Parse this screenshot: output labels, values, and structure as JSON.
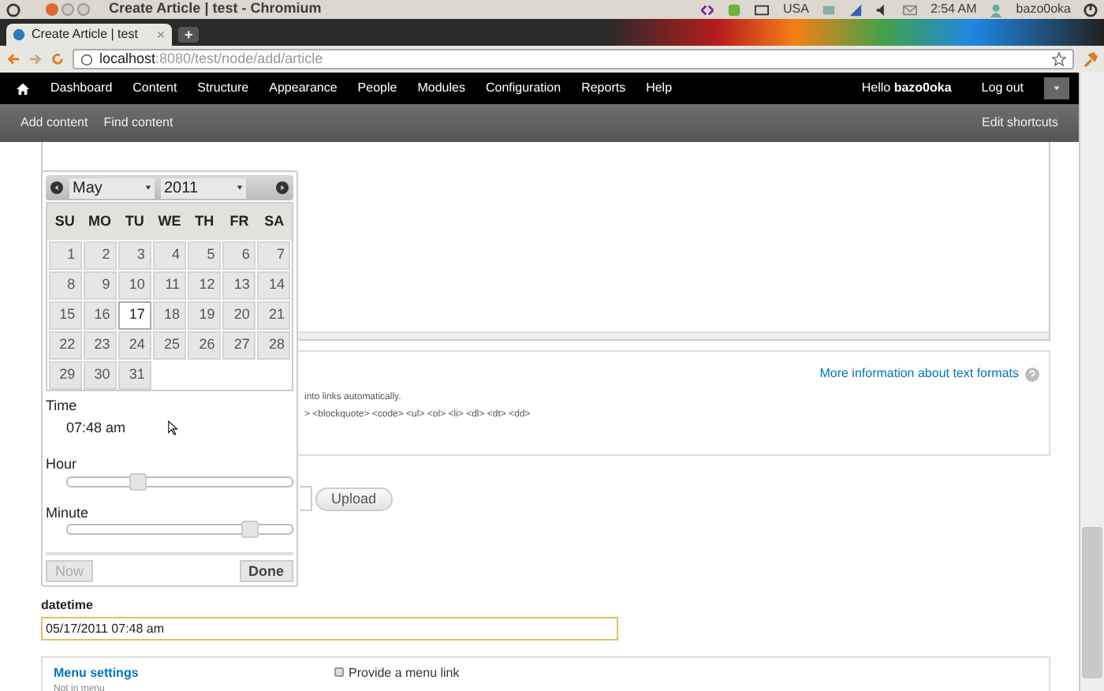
{
  "panel": {
    "window_title": "Create Article | test - Chromium",
    "keyboard": "USA",
    "clock": "2:54 AM",
    "user": "bazo0oka"
  },
  "tabs": [
    {
      "label": "Create Article | test",
      "selected": true
    }
  ],
  "new_tab": "+",
  "address": {
    "host": "localhost",
    "rest": ":8080/test/node/add/article"
  },
  "toolbar": {
    "items": [
      "Dashboard",
      "Content",
      "Structure",
      "Appearance",
      "People",
      "Modules",
      "Configuration",
      "Reports",
      "Help"
    ],
    "greeting": "Hello **bazo0oka**",
    "logout": "Log out"
  },
  "shortcuts": {
    "items": [
      "Add content",
      "Find content"
    ],
    "edit": "Edit shortcuts"
  },
  "text_format": {
    "help_link": "More information about text formats",
    "line_1": "into links automatically.",
    "line_2": "> <blockquote> <code> <ul> <ol> <li> <dl> <dt> <dd>"
  },
  "upload_button": "Upload",
  "datetime": {
    "label": "datetime",
    "value": "05/17/2011 07:48 am"
  },
  "menu_settings": {
    "title": "Menu settings",
    "summary": "Not in menu",
    "checkbox": {
      "label": "Provide a menu link",
      "checked": false
    }
  },
  "datepicker": {
    "month": "May",
    "year": "2011",
    "weekdays": [
      "SU",
      "MO",
      "TU",
      "WE",
      "TH",
      "FR",
      "SA"
    ],
    "days": [
      {
        "label": "1",
        "selected": false
      },
      {
        "label": "2",
        "selected": false
      },
      {
        "label": "3",
        "selected": false
      },
      {
        "label": "4",
        "selected": false
      },
      {
        "label": "5",
        "selected": false
      },
      {
        "label": "6",
        "selected": false
      },
      {
        "label": "7",
        "selected": false
      },
      {
        "label": "8",
        "selected": false
      },
      {
        "label": "9",
        "selected": false
      },
      {
        "label": "10",
        "selected": false
      },
      {
        "label": "11",
        "selected": false
      },
      {
        "label": "12",
        "selected": false
      },
      {
        "label": "13",
        "selected": false
      },
      {
        "label": "14",
        "selected": false
      },
      {
        "label": "15",
        "selected": false
      },
      {
        "label": "16",
        "selected": false
      },
      {
        "label": "17",
        "selected": true
      },
      {
        "label": "18",
        "selected": false
      },
      {
        "label": "19",
        "selected": false
      },
      {
        "label": "20",
        "selected": false
      },
      {
        "label": "21",
        "selected": false
      },
      {
        "label": "22",
        "selected": false
      },
      {
        "label": "23",
        "selected": false
      },
      {
        "label": "24",
        "selected": false
      },
      {
        "label": "25",
        "selected": false
      },
      {
        "label": "26",
        "selected": false
      },
      {
        "label": "27",
        "selected": false
      },
      {
        "label": "28",
        "selected": false
      },
      {
        "label": "29",
        "selected": false
      },
      {
        "label": "30",
        "selected": false
      },
      {
        "label": "31",
        "selected": false
      }
    ],
    "time_label": "Time",
    "time_value": "07:48 am",
    "sliders": [
      {
        "label": "Hour",
        "level": 0.31
      },
      {
        "label": "Minute",
        "level": 0.81
      }
    ],
    "buttons": [
      {
        "label": "Now",
        "disabled": true
      },
      {
        "label": "Done",
        "disabled": false
      }
    ]
  }
}
